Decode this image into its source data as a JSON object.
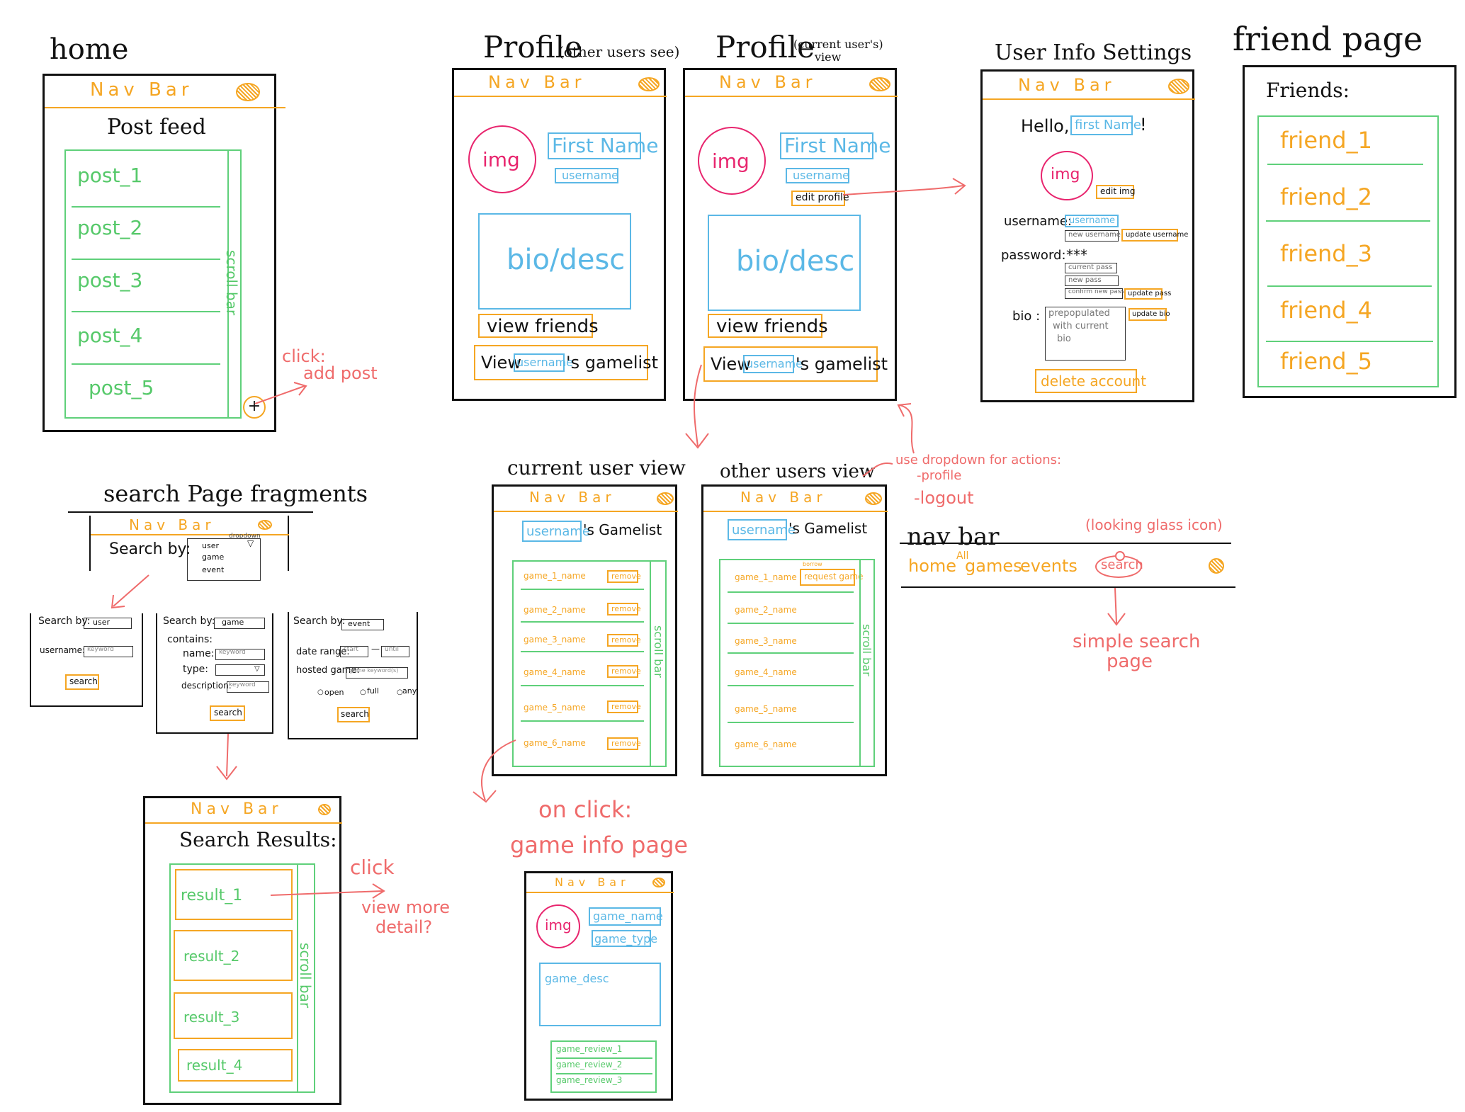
{
  "home": {
    "title": "home",
    "nav": "Nav Bar",
    "feed_title": "Post feed",
    "posts": [
      "post_1",
      "post_2",
      "post_3",
      "post_4",
      "post_5"
    ],
    "scroll": "scroll bar",
    "plus": "+",
    "note": [
      "click:",
      "add post"
    ]
  },
  "profile_other": {
    "title": "Profile",
    "subtitle": "(other users see)",
    "nav": "Nav Bar",
    "img": "img",
    "first_name": "First Name",
    "username": "username",
    "bio": "bio/desc",
    "view_friends": "view friends",
    "view": "View",
    "username_tag": "username",
    "gamelist": "'s gamelist"
  },
  "profile_current": {
    "title": "Profile",
    "subtitle": [
      "(current user's)",
      "view"
    ],
    "nav": "Nav Bar",
    "img": "img",
    "first_name": "First Name",
    "username": "username",
    "edit_profile": "edit profile",
    "bio": "bio/desc",
    "view_friends": "view friends",
    "view": "View",
    "username_tag": "username",
    "gamelist": "'s gamelist"
  },
  "settings": {
    "title": "User Info Settings",
    "nav": "Nav Bar",
    "hello": "Hello,",
    "first_name": "first Name",
    "bang": "!",
    "img": "img",
    "edit_img": "edit img",
    "username_label": "username:",
    "username_field": "username",
    "new_username": "new username",
    "update_username": "update username",
    "password_label": "password:",
    "password_mask": "***",
    "current_pass": "current pass",
    "new_pass": "new pass",
    "confirm_pass": "confirm new pass",
    "update_pass": "update pass",
    "bio_label": "bio :",
    "bio_placeholder": [
      "prepopulated",
      "with current",
      "bio"
    ],
    "update_bio": "update bio",
    "delete": "delete account"
  },
  "friends": {
    "title": "friend page",
    "heading": "Friends:",
    "items": [
      "friend_1",
      "friend_2",
      "friend_3",
      "friend_4",
      "friend_5"
    ]
  },
  "search": {
    "title": "search Page fragments",
    "nav": "Nav Bar",
    "search_by": "Search by:",
    "dropdown_label": "dropdown",
    "options": [
      "user",
      "game",
      "event"
    ],
    "user_frag": {
      "search_by": "Search by:",
      "value": "user",
      "username_label": "username:",
      "username_ph": "keyword",
      "button": "search"
    },
    "game_frag": {
      "search_by": "Search by:",
      "value": "game",
      "contains": "contains:",
      "name_label": "name:",
      "name_ph": "keyword",
      "type_label": "type:",
      "desc_label": "description:",
      "desc_ph": "keyword",
      "button": "search"
    },
    "event_frag": {
      "search_by": "Search by:",
      "value": "event",
      "date_label": "date range:",
      "start": "start",
      "dash": "—",
      "until": "until",
      "hosted_label": "hosted game:",
      "hosted_ph": "game keyword(s)",
      "open": "open",
      "full": "full",
      "any": "any",
      "button": "search"
    }
  },
  "results": {
    "nav": "Nav Bar",
    "heading": "Search Results:",
    "items": [
      "result_1",
      "result_2",
      "result_3",
      "result_4"
    ],
    "scroll": "scroll bar",
    "note": [
      "click",
      "view more",
      "detail?"
    ]
  },
  "gamelist_current": {
    "title": "current user view",
    "nav": "Nav Bar",
    "username": "username",
    "gamelist": "'s Gamelist",
    "games": [
      "game_1_name",
      "game_2_name",
      "game_3_name",
      "game_4_name",
      "game_5_name",
      "game_6_name"
    ],
    "remove": "remove",
    "scroll": "scroll bar"
  },
  "gamelist_other": {
    "title": "other users view",
    "nav": "Nav Bar",
    "username": "username",
    "gamelist": "'s Gamelist",
    "games": [
      "game_1_name",
      "game_2_name",
      "game_3_name",
      "game_4_name",
      "game_5_name",
      "game_6_name"
    ],
    "request_small": "borrow",
    "request": "request game",
    "scroll": "scroll bar"
  },
  "dropdown_note": [
    "use dropdown for actions:",
    "-profile",
    "-logout"
  ],
  "navbar": {
    "title": "nav bar",
    "icon_note": "(looking glass icon)",
    "items": [
      "home",
      "games",
      "events",
      "search"
    ],
    "all": "All",
    "note": [
      "simple search",
      "page"
    ]
  },
  "game_info": {
    "note": [
      "on click:",
      "game info page"
    ],
    "nav": "Nav Bar",
    "img": "img",
    "game_name": "game_name",
    "game_type": "game_type",
    "game_desc": "game_desc",
    "reviews": [
      "game_review_1",
      "game_review_2",
      "game_review_3"
    ]
  },
  "colors": {
    "nav": "#f5a623",
    "list": "#56c96a",
    "field": "#5bb8e6",
    "image": "#e8256e",
    "note": "#ef6b6b",
    "frame": "#111111"
  }
}
